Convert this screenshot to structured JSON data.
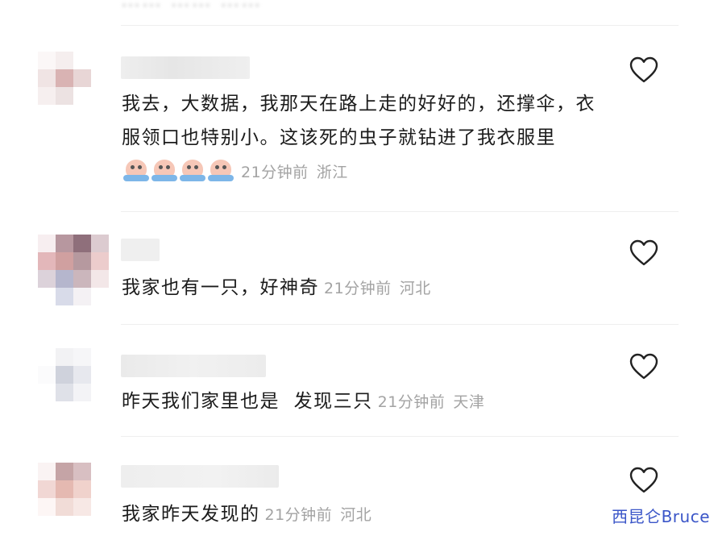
{
  "top_fragment": "…… …… ……",
  "heart_icon": "heart-outline-icon",
  "comments": [
    {
      "text": "我去，大数据，我那天在路上走的好好的，还撑伞，衣服领口也特别小。这该死的虫子就钻进了我衣服里",
      "emojis": [
        "crying-emoji",
        "crying-emoji",
        "crying-emoji",
        "crying-emoji"
      ],
      "time": "21分钟前",
      "location": "浙江"
    },
    {
      "text": "我家也有一只，好神奇",
      "time": "21分钟前",
      "location": "河北"
    },
    {
      "text": "昨天我们家里也是  发现三只",
      "time": "21分钟前",
      "location": "天津"
    },
    {
      "text": "我家昨天发现的",
      "time": "21分钟前",
      "location": "河北"
    }
  ],
  "watermark": "西昆仑Bruce",
  "colors": {
    "text": "#1b1b1b",
    "meta": "#a3a3a3",
    "divider": "#efefef",
    "watermark": "#3b56c8"
  }
}
